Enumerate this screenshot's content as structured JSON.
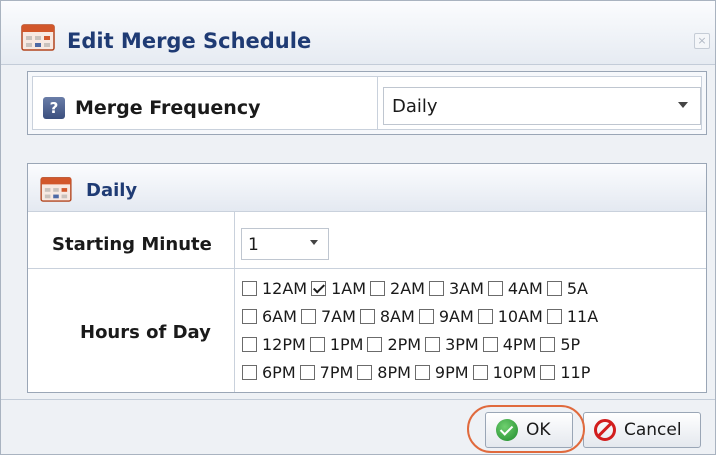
{
  "dialog": {
    "title": "Edit Merge Schedule",
    "close_label": "×"
  },
  "merge_frequency": {
    "label": "Merge Frequency",
    "help_glyph": "?",
    "selected": "Daily"
  },
  "daily": {
    "title": "Daily",
    "starting_minute_label": "Starting Minute",
    "starting_minute_value": "1",
    "hours_of_day_label": "Hours of Day",
    "hours": [
      [
        {
          "label": "12AM",
          "checked": false
        },
        {
          "label": "1AM",
          "checked": true
        },
        {
          "label": "2AM",
          "checked": false
        },
        {
          "label": "3AM",
          "checked": false
        },
        {
          "label": "4AM",
          "checked": false
        },
        {
          "label": "5A",
          "checked": false
        }
      ],
      [
        {
          "label": "6AM",
          "checked": false
        },
        {
          "label": "7AM",
          "checked": false
        },
        {
          "label": "8AM",
          "checked": false
        },
        {
          "label": "9AM",
          "checked": false
        },
        {
          "label": "10AM",
          "checked": false
        },
        {
          "label": "11A",
          "checked": false
        }
      ],
      [
        {
          "label": "12PM",
          "checked": false
        },
        {
          "label": "1PM",
          "checked": false
        },
        {
          "label": "2PM",
          "checked": false
        },
        {
          "label": "3PM",
          "checked": false
        },
        {
          "label": "4PM",
          "checked": false
        },
        {
          "label": "5P",
          "checked": false
        }
      ],
      [
        {
          "label": "6PM",
          "checked": false
        },
        {
          "label": "7PM",
          "checked": false
        },
        {
          "label": "8PM",
          "checked": false
        },
        {
          "label": "9PM",
          "checked": false
        },
        {
          "label": "10PM",
          "checked": false
        },
        {
          "label": "11P",
          "checked": false
        }
      ]
    ]
  },
  "footer": {
    "ok_label": "OK",
    "cancel_label": "Cancel"
  },
  "colors": {
    "title_text": "#1f3b74",
    "highlight_ring": "#e06a3d",
    "ok_icon": "#1f8a2c",
    "cancel_icon": "#d21d1d"
  },
  "icons": {
    "title": "calendar-icon",
    "help": "help-icon",
    "daily": "calendar-icon",
    "ok": "check-circle-icon",
    "cancel": "prohibited-icon",
    "close": "close-icon"
  }
}
